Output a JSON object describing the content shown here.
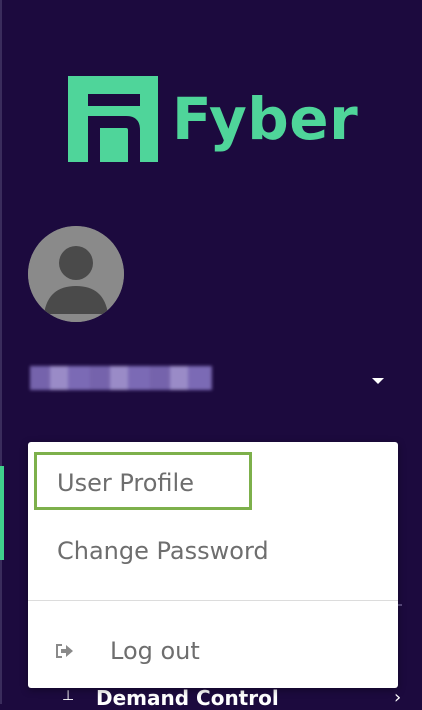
{
  "brand": {
    "name": "Fyber",
    "color": "#4fd59a"
  },
  "user": {
    "avatar_icon": "user-avatar-icon",
    "dropdown_icon": "caret-down-icon"
  },
  "menu": {
    "user_profile": "User Profile",
    "change_password": "Change Password",
    "log_out": "Log out",
    "log_out_icon": "sign-out-icon",
    "highlight_color": "#7db04b"
  },
  "nav": {
    "partial_item_label": "Demand Control",
    "partial_item_icon": "sliders-icon"
  },
  "colors": {
    "sidebar_bg": "#1c0a3e",
    "menu_bg": "#ffffff",
    "menu_text": "#6e6e6e"
  }
}
